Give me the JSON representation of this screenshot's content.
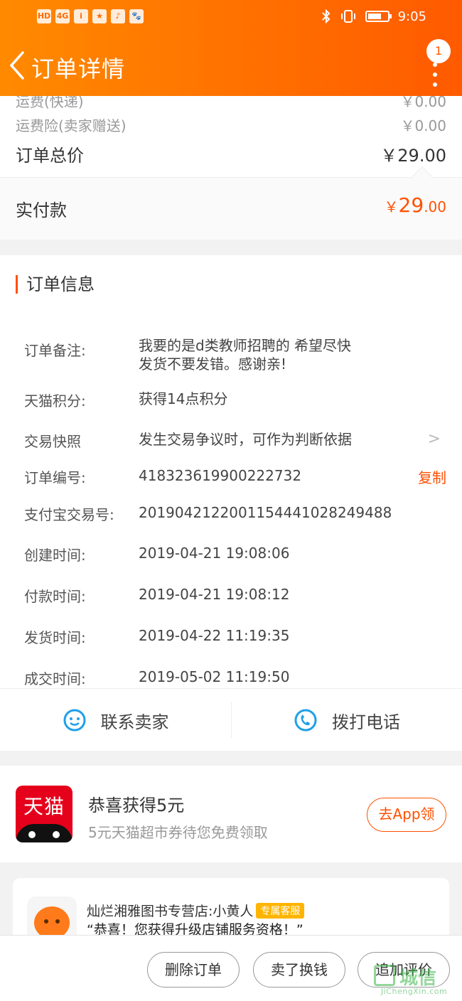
{
  "status_bar": {
    "time": "9:05",
    "left_icons": [
      "HD",
      "4G",
      "i",
      "★",
      "♪",
      "🐾"
    ],
    "battery_level": 0.7
  },
  "header": {
    "title": "订单详情",
    "badge_count": "1"
  },
  "price": {
    "shipping_label": "运费(快递)",
    "shipping_value": "￥0.00",
    "insurance_label": "运费险(卖家赠送)",
    "insurance_value": "￥0.00",
    "total_label": "订单总价",
    "total_value": "￥29.00",
    "paid_label": "实付款",
    "paid_currency": "￥",
    "paid_int": "29",
    "paid_dec": ".00"
  },
  "order_info": {
    "title": "订单信息",
    "rows": [
      {
        "label": "订单备注:",
        "value_line1": "我要的是d类教师招聘的  希望尽快",
        "value_line2": "发货不要发错。感谢亲!"
      },
      {
        "label": "天猫积分:",
        "value": "获得14点积分"
      },
      {
        "label": "交易快照",
        "value": "发生交易争议时，可作为判断依据"
      },
      {
        "label": "订单编号:",
        "value": "418323619900222732",
        "action": "复制"
      },
      {
        "label": "支付宝交易号:",
        "value": "2019042122001154441028249488"
      },
      {
        "label": "创建时间:",
        "value": "2019-04-21 19:08:06"
      },
      {
        "label": "付款时间:",
        "value": "2019-04-21 19:08:12"
      },
      {
        "label": "发货时间:",
        "value": "2019-04-22 11:19:35"
      },
      {
        "label": "成交时间:",
        "value": "2019-05-02 11:19:50"
      }
    ]
  },
  "contact": {
    "seller_label": "联系卖家",
    "phone_label": "拨打电话"
  },
  "promo": {
    "logo_text": "天猫",
    "title": "恭喜获得5元",
    "subtitle": "5元天猫超市券待您免费领取",
    "button": "去App领"
  },
  "shop": {
    "name": "灿烂湘雅图书专营店:小黄人",
    "tag": "专属客服",
    "message": "“恭喜！您获得升级店铺服务资格！”"
  },
  "bottom_actions": [
    "删除订单",
    "卖了换钱",
    "追加评价"
  ],
  "watermark": {
    "text": "城信",
    "url": "JiChengXin.com"
  },
  "colors": {
    "brand_orange": "#ff5a00",
    "accent_red": "#ff5000",
    "tmall_red": "#e5001b"
  }
}
